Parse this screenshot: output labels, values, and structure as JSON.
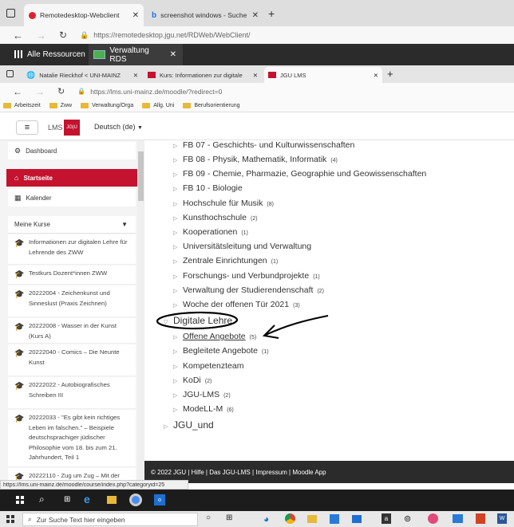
{
  "outer_browser": {
    "tabs": [
      {
        "label": "Remotedesktop-Webclient"
      },
      {
        "label": "screenshot windows - Suche"
      }
    ],
    "url": "https://remotedesktop.jgu.net/RDWeb/WebClient/",
    "url_host": "remotedesktop.jgu.net"
  },
  "rds_bar": {
    "all_resources": "Alle Ressourcen",
    "session_tab": "Verwaltung RDS"
  },
  "inner_browser": {
    "tabs": [
      {
        "label": "Natalie Rieckhof < UNI-MAINZ"
      },
      {
        "label": "Kurs: Informationen zur digitale"
      },
      {
        "label": "JGU LMS"
      }
    ],
    "url": "https://lms.uni-mainz.de/moodle/?redirect=0",
    "url_host": "lms.uni-mainz.de",
    "bookmarks": [
      "Arbeitszeit",
      "Zww",
      "Verwaltung/Orga",
      "Allg. Uni",
      "Berufsorientierung"
    ]
  },
  "moodle_header": {
    "logo_lms": "LMS",
    "logo_jgu": "JG|U",
    "language": "Deutsch (de)"
  },
  "sidebar": {
    "dashboard": "Dashboard",
    "startseite": "Startseite",
    "kalender": "Kalender",
    "my_courses_header": "Meine Kurse",
    "courses": [
      {
        "label": "Informationen zur digitalen Lehre für Lehrende des ZWW"
      },
      {
        "label": "Testkurs Dozent*innen ZWW"
      },
      {
        "label": "20222004 - Zeichenkunst und Sinneslust (Praxis Zeichnen)"
      },
      {
        "label": "20222008 - Wasser in der Kunst (Kurs A)"
      },
      {
        "label": "20222040 - Comics – Die Neunte Kunst"
      },
      {
        "label": "20222022 - Autobiografisches Schreiben III"
      },
      {
        "label": "20222033 - \"Es gibt kein richtiges Leben im falschen.\" – Beispiele deutschsprachiger jüdischer Philosophie vom 18. bis zum 21. Jahrhundert, Teil 1"
      },
      {
        "label": "20222110 - Zug um Zug – Mit der"
      }
    ]
  },
  "categories": [
    {
      "label": "FB 07 - Geschichts- und Kulturwissenschaften",
      "count": ""
    },
    {
      "label": "FB 08 - Physik, Mathematik, Informatik",
      "count": "(4)"
    },
    {
      "label": "FB 09 - Chemie, Pharmazie, Geographie und Geowissenschaften",
      "count": ""
    },
    {
      "label": "FB 10 - Biologie",
      "count": ""
    },
    {
      "label": "Hochschule für Musik",
      "count": "(8)"
    },
    {
      "label": "Kunsthochschule",
      "count": "(2)"
    },
    {
      "label": "Kooperationen",
      "count": "(1)"
    },
    {
      "label": "Universitätsleitung und Verwaltung",
      "count": ""
    },
    {
      "label": "Zentrale Einrichtungen",
      "count": "(1)"
    },
    {
      "label": "Forschungs- und Verbundprojekte",
      "count": "(1)"
    },
    {
      "label": "Verwaltung der Studierendenschaft",
      "count": "(2)"
    },
    {
      "label": "Woche der offenen Tür 2021",
      "count": "(3)"
    }
  ],
  "digitale_lehre": {
    "label": "Digitale Lehre",
    "children": [
      {
        "label": "Offene Angebote",
        "count": "(5)"
      },
      {
        "label": "Begleitete Angebote",
        "count": "(1)"
      },
      {
        "label": "Kompetenzteam",
        "count": ""
      },
      {
        "label": "KoDi",
        "count": "(2)"
      },
      {
        "label": "JGU-LMS",
        "count": "(2)"
      },
      {
        "label": "ModeLL-M",
        "count": "(6)"
      }
    ]
  },
  "jgu_und": "JGU_und",
  "footer": "© 2022 JGU | Hilfe | Das JGU-LMS | Impressum | Moodle App",
  "status_url": "https://lms.uni-mainz.de/moodle/course/index.php?categoryid=25",
  "taskbar": {
    "search_placeholder": "Zur Suche Text hier eingeben"
  },
  "colors": {
    "jgu_red": "#c4122f",
    "dark_bar": "#2b2b2b",
    "annotation_ink": "#000000"
  }
}
